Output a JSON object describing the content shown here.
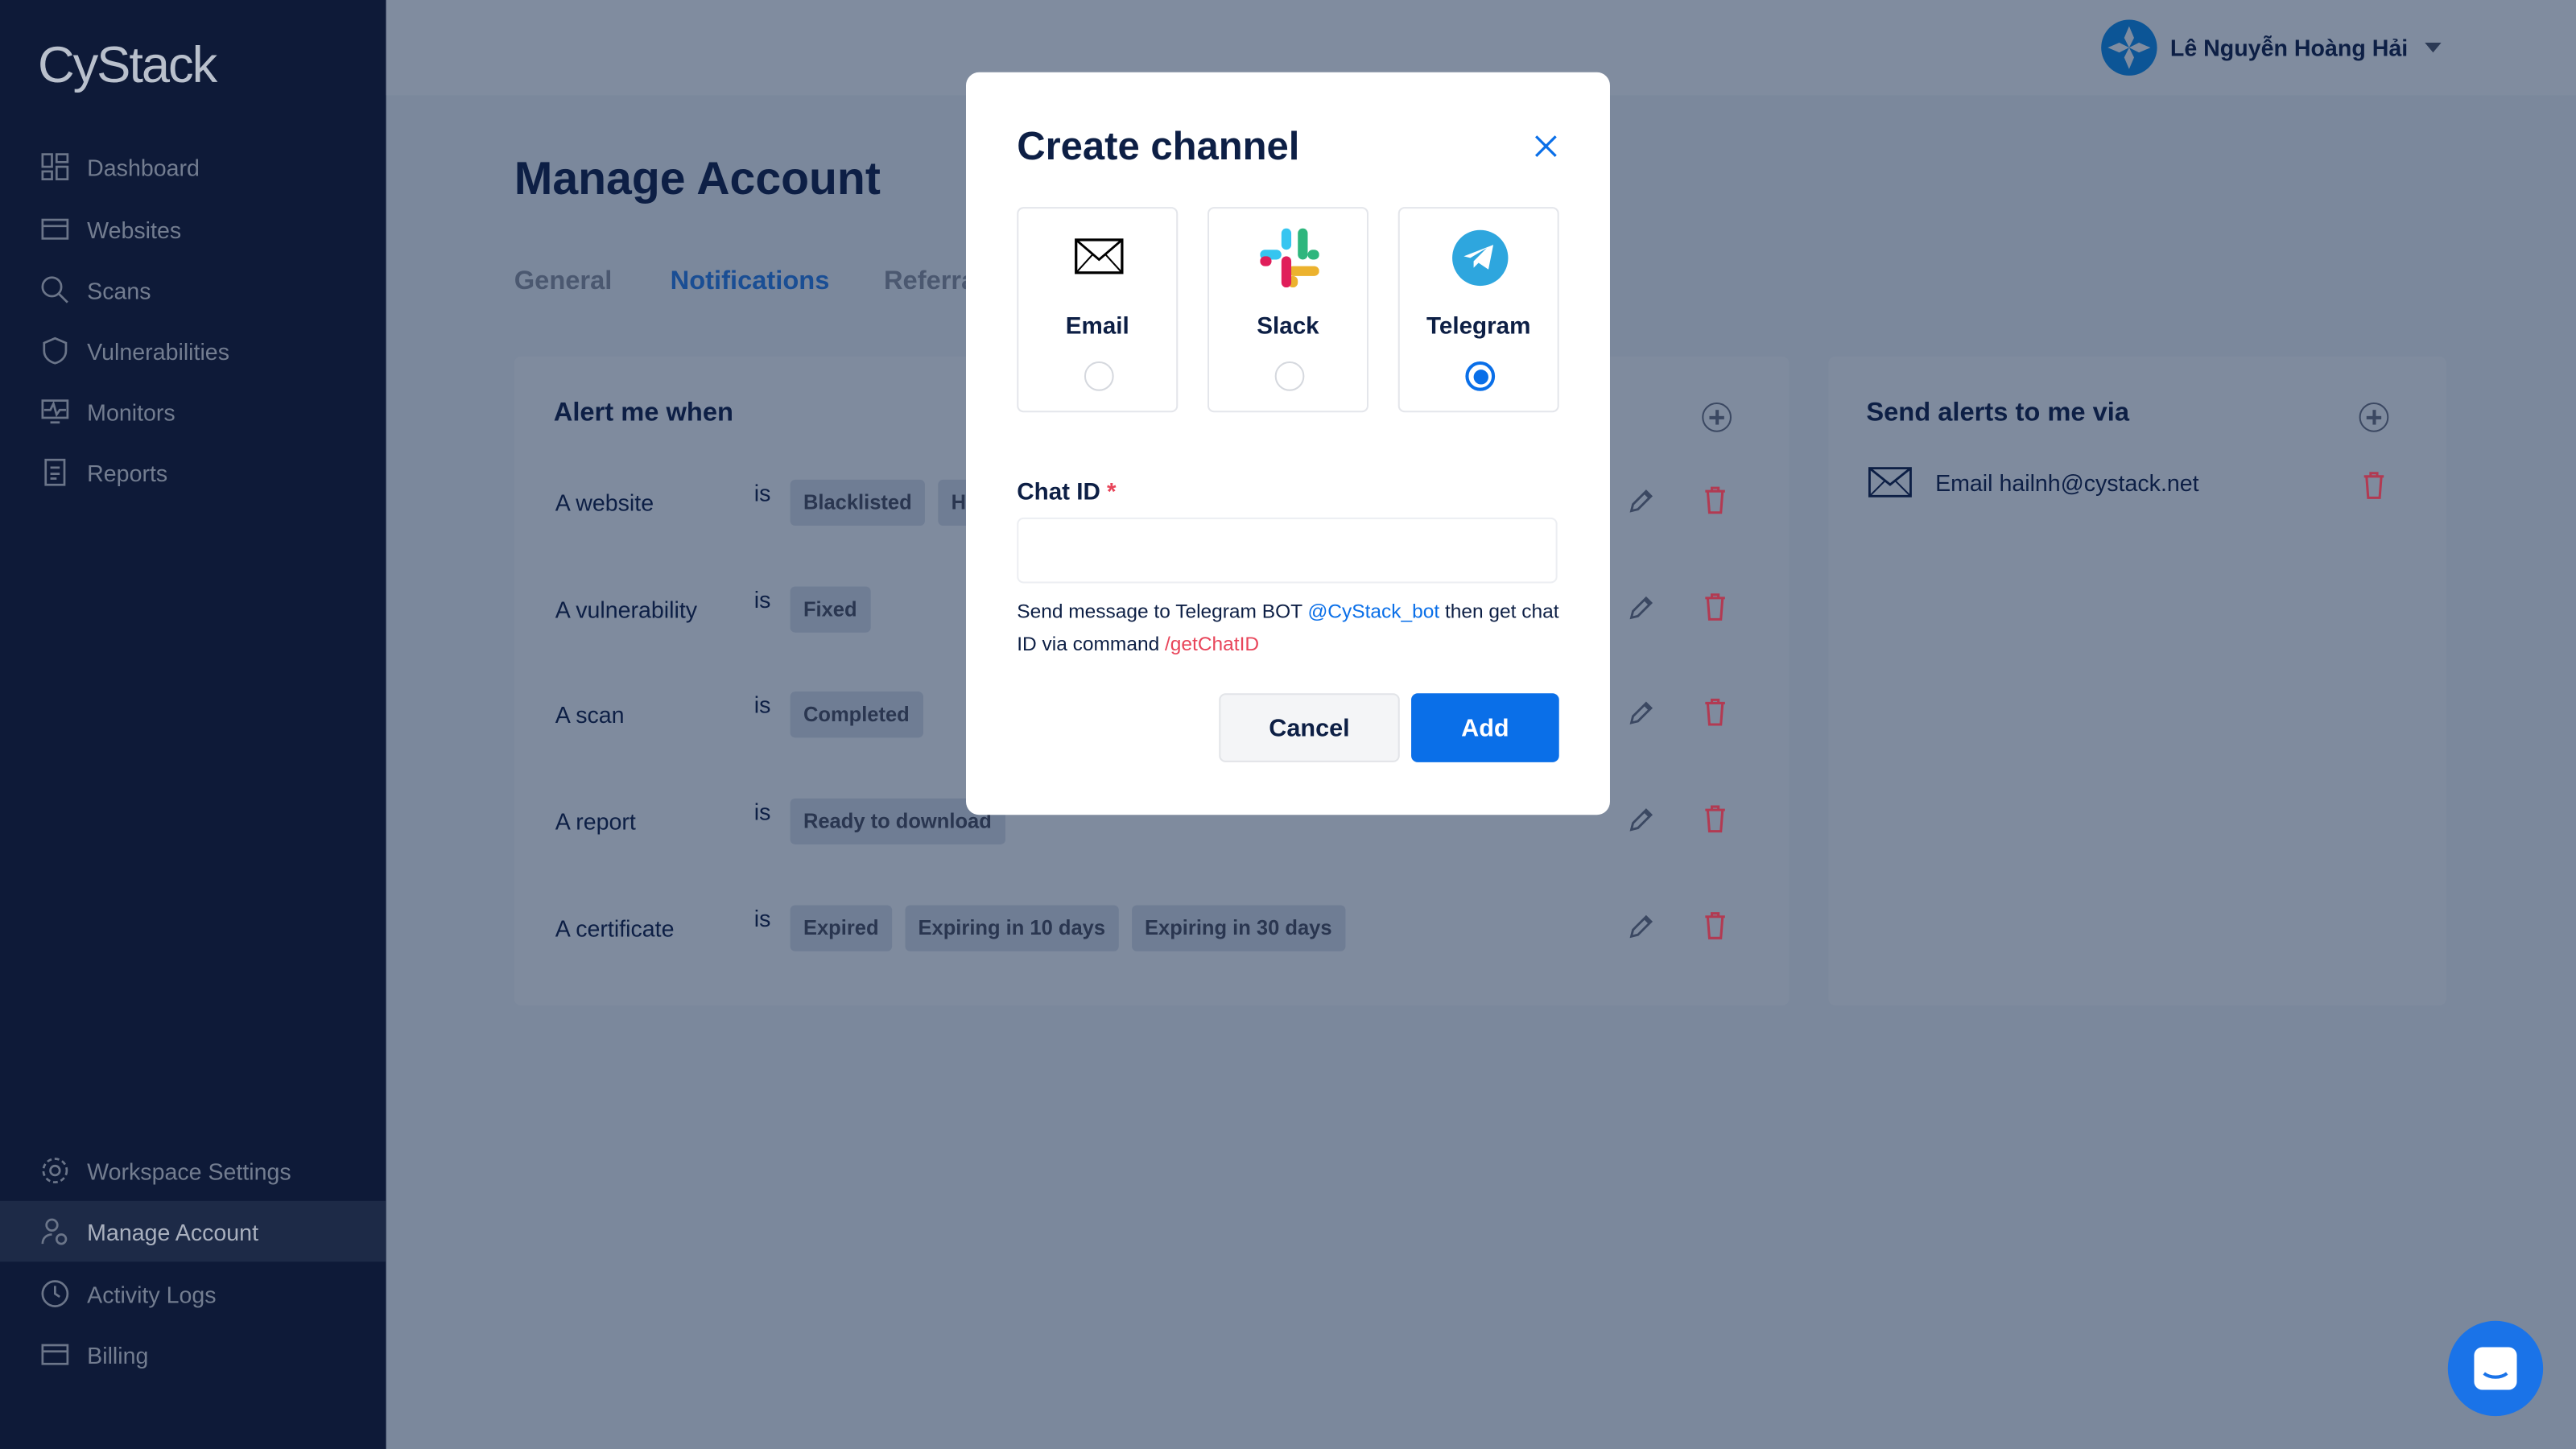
{
  "sidebar": {
    "logo": "CyStack",
    "top_items": [
      {
        "label": "Dashboard",
        "icon": "dashboard-icon"
      },
      {
        "label": "Websites",
        "icon": "browser-icon"
      },
      {
        "label": "Scans",
        "icon": "scan-icon"
      },
      {
        "label": "Vulnerabilities",
        "icon": "shield-icon"
      },
      {
        "label": "Monitors",
        "icon": "monitor-icon"
      },
      {
        "label": "Reports",
        "icon": "report-icon"
      }
    ],
    "bottom_items": [
      {
        "label": "Workspace Settings",
        "icon": "gear-icon"
      },
      {
        "label": "Manage Account",
        "icon": "user-gear-icon",
        "active": true
      },
      {
        "label": "Activity Logs",
        "icon": "clock-icon"
      },
      {
        "label": "Billing",
        "icon": "card-icon"
      }
    ]
  },
  "header": {
    "user_name": "Lê Nguyễn Hoàng Hải"
  },
  "page": {
    "title": "Manage Account",
    "tabs": [
      {
        "label": "General"
      },
      {
        "label": "Notifications",
        "active": true
      },
      {
        "label": "Referrals"
      }
    ]
  },
  "alerts": {
    "title": "Alert me when",
    "is_label": "is",
    "rows": [
      {
        "subject": "A website",
        "tags": [
          "Blacklisted",
          "Hacked"
        ]
      },
      {
        "subject": "A vulnerability",
        "tags": [
          "Fixed"
        ]
      },
      {
        "subject": "A scan",
        "tags": [
          "Completed"
        ]
      },
      {
        "subject": "A report",
        "tags": [
          "Ready to download"
        ]
      },
      {
        "subject": "A certificate",
        "tags": [
          "Expired",
          "Expiring in 10 days",
          "Expiring in 30 days"
        ]
      }
    ]
  },
  "send_via": {
    "title": "Send alerts to me via",
    "channels": [
      {
        "label": "Email hailnh@cystack.net",
        "icon": "envelope-icon"
      }
    ]
  },
  "modal": {
    "title": "Create channel",
    "options": [
      {
        "label": "Email",
        "selected": false
      },
      {
        "label": "Slack",
        "selected": false
      },
      {
        "label": "Telegram",
        "selected": true
      }
    ],
    "chat_id_label": "Chat ID",
    "required_mark": "*",
    "chat_id_value": "",
    "hint_1": "Send message to Telegram BOT ",
    "bot": "@CyStack_bot",
    "hint_2": " then get chat ID via command ",
    "command": "/getChatID",
    "cancel": "Cancel",
    "add": "Add"
  },
  "colors": {
    "primary": "#0a6fe8",
    "danger": "#e8455a",
    "navy": "#0d1f45"
  }
}
